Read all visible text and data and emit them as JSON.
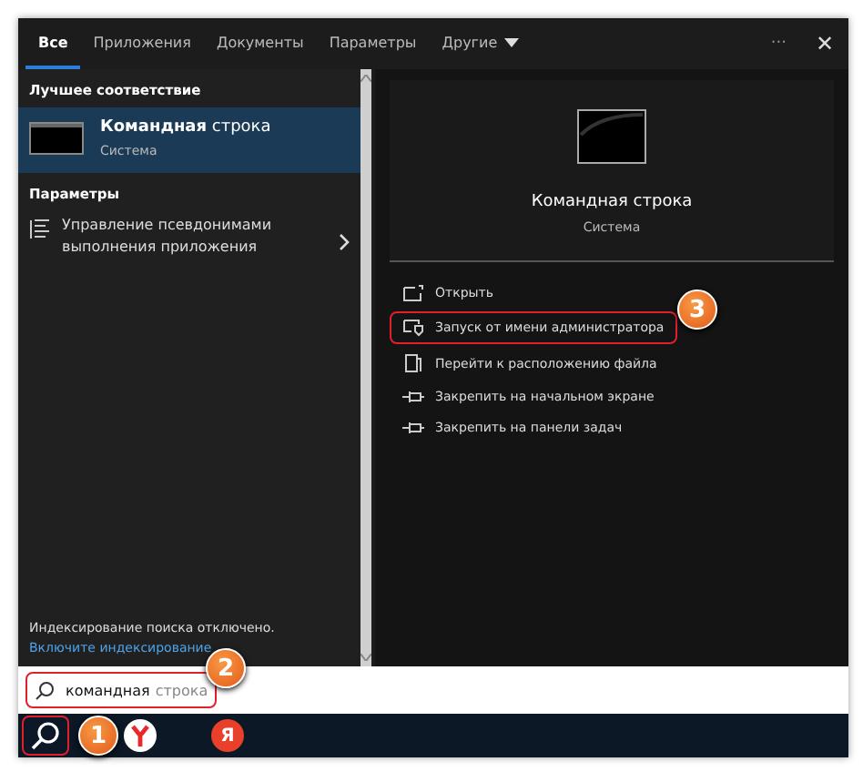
{
  "tabs": [
    {
      "label": "Все",
      "selected": true,
      "kind": "plain"
    },
    {
      "label": "Приложения",
      "selected": false,
      "kind": "plain"
    },
    {
      "label": "Документы",
      "selected": false,
      "kind": "plain"
    },
    {
      "label": "Параметры",
      "selected": false,
      "kind": "plain"
    },
    {
      "label": "Другие",
      "selected": false,
      "kind": "dropdown"
    }
  ],
  "window_controls": {
    "more": "···",
    "close": "✕"
  },
  "best_match": {
    "heading": "Лучшее соответствие",
    "item": {
      "title": "**Командная** строка",
      "subtitle": "Система",
      "selected": true
    }
  },
  "settings": {
    "heading": "Параметры",
    "items": [
      {
        "title": "Управление псевдонимами выполнения приложения",
        "selected": false
      }
    ]
  },
  "index_notice": {
    "text": "Индексирование поиска отключено.",
    "link": "Включите индексирование"
  },
  "preview": {
    "title": "Командная строка",
    "subtitle": "Система"
  },
  "actions": [
    {
      "label": "Открыть",
      "kind": "open",
      "highlighted": false
    },
    {
      "label": "Запуск от имени администратора",
      "kind": "admin",
      "highlighted": true,
      "callout": "3"
    },
    {
      "label": "Перейти к расположению файла",
      "kind": "folder",
      "highlighted": false
    },
    {
      "label": "Закрепить на начальном экране",
      "kind": "pin",
      "highlighted": false
    },
    {
      "label": "Закрепить на панели задач",
      "kind": "pin",
      "highlighted": false
    }
  ],
  "search": {
    "value": "командная",
    "suggestion": "строка",
    "highlighted": true,
    "callout": "2"
  },
  "taskbar": [
    {
      "kind": "search",
      "highlighted": true,
      "callout": "1"
    },
    {
      "kind": "browser",
      "highlighted": false
    },
    {
      "kind": "letter",
      "label": "Я",
      "highlighted": false
    }
  ]
}
